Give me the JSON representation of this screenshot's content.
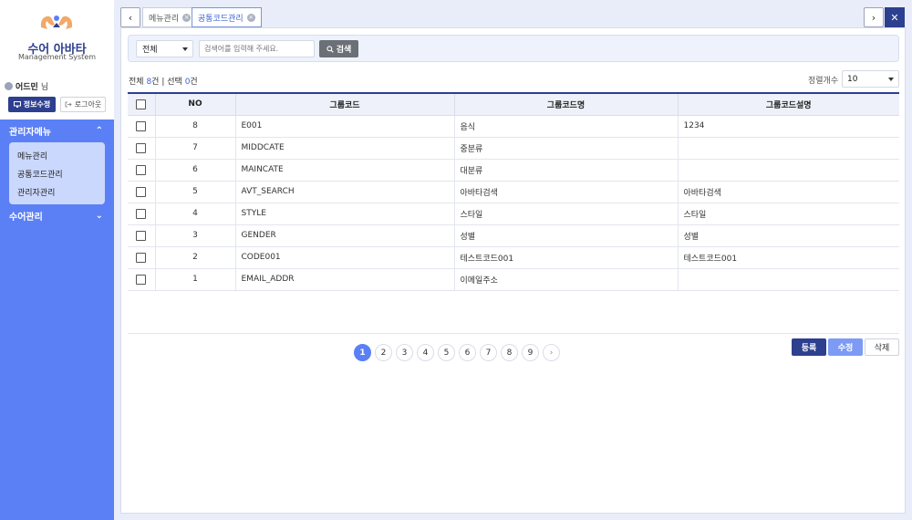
{
  "brand": {
    "title": "수어 아바타",
    "subtitle": "Management System",
    "icon": "hands-logo-icon"
  },
  "user": {
    "name": "어드민",
    "suffix": "님",
    "info_button": "정보수정",
    "logout_button": "로그아웃"
  },
  "menu": {
    "sections": [
      {
        "label": "관리자메뉴",
        "expanded": true,
        "items": [
          "메뉴관리",
          "공통코드관리",
          "관리자관리"
        ]
      },
      {
        "label": "수어관리",
        "expanded": false,
        "items": []
      }
    ]
  },
  "tabs": [
    {
      "label": "메뉴관리",
      "active": false
    },
    {
      "label": "공통코드관리",
      "active": true
    }
  ],
  "search": {
    "select_value": "전체",
    "placeholder": "검색어를 입력해 주세요.",
    "button": "검색"
  },
  "summary": {
    "total_label": "전체",
    "total_count": "8",
    "unit": "건",
    "sep": "|",
    "selected_label": "선택",
    "selected_count": "0"
  },
  "sort": {
    "label": "정렬개수",
    "value": "10"
  },
  "table": {
    "headers": [
      "NO",
      "그룹코드",
      "그룹코드명",
      "그룹코드설명"
    ],
    "rows": [
      {
        "no": "8",
        "code": "E001",
        "name": "음식",
        "desc": "1234"
      },
      {
        "no": "7",
        "code": "MIDDCATE",
        "name": "중분류",
        "desc": ""
      },
      {
        "no": "6",
        "code": "MAINCATE",
        "name": "대분류",
        "desc": ""
      },
      {
        "no": "5",
        "code": "AVT_SEARCH",
        "name": "아바타검색",
        "desc": "아바타검색"
      },
      {
        "no": "4",
        "code": "STYLE",
        "name": "스타일",
        "desc": "스타일"
      },
      {
        "no": "3",
        "code": "GENDER",
        "name": "성별",
        "desc": "성별"
      },
      {
        "no": "2",
        "code": "CODE001",
        "name": "테스트코드001",
        "desc": "테스트코드001"
      },
      {
        "no": "1",
        "code": "EMAIL_ADDR",
        "name": "이메일주소",
        "desc": ""
      }
    ]
  },
  "pagination": {
    "pages": [
      "1",
      "2",
      "3",
      "4",
      "5",
      "6",
      "7",
      "8",
      "9"
    ],
    "current": "1"
  },
  "actions": {
    "register": "등록",
    "edit": "수정",
    "delete": "삭제"
  },
  "colors": {
    "primary": "#2d3f8f",
    "accent": "#5b80f5",
    "sidebar": "#5b80f5"
  }
}
